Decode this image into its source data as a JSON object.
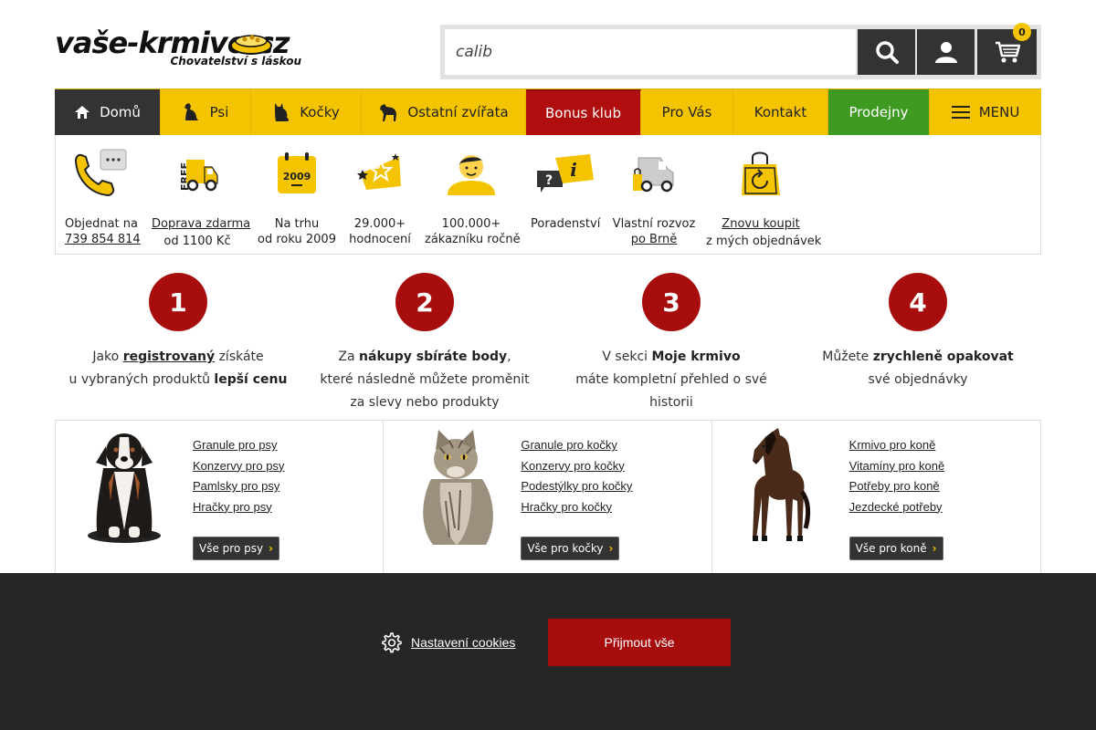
{
  "header": {
    "logo_text": "vaše-krmivo.cz",
    "logo_subtitle": "Chovatelství s láskou",
    "search": {
      "value": "calib",
      "placeholder": ""
    },
    "cart_count": "0"
  },
  "nav": {
    "items": [
      {
        "label": "Domů",
        "icon": "home-icon"
      },
      {
        "label": "Psi",
        "icon": "dog-icon"
      },
      {
        "label": "Kočky",
        "icon": "cat-icon"
      },
      {
        "label": "Ostatní zvířata",
        "icon": "horse-icon"
      },
      {
        "label": "Bonus klub"
      },
      {
        "label": "Pro Vás"
      },
      {
        "label": "Kontakt"
      },
      {
        "label": "Prodejny"
      },
      {
        "label": "MENU",
        "icon": "hamburger-icon"
      }
    ]
  },
  "benefits": [
    {
      "line1": "Objednat na",
      "line2": "739 854 814",
      "icon": "phone-icon"
    },
    {
      "line1": "Doprava zdarma",
      "line2": "od 1100 Kč",
      "icon": "free-delivery-icon"
    },
    {
      "line1": "Na trhu",
      "line2": "od roku 2009",
      "icon": "calendar-icon",
      "calendar_year": "2009"
    },
    {
      "line1": "29.000+",
      "line2": "hodnocení",
      "icon": "stars-icon"
    },
    {
      "line1": "100.000+",
      "line2": "zákazníku ročně",
      "icon": "customer-icon"
    },
    {
      "line1": "Poradenství",
      "line2": "",
      "icon": "advice-icon"
    },
    {
      "line1": "Vlastní rozvoz",
      "line2": "po Brně",
      "icon": "van-icon"
    },
    {
      "line1": "Znovu koupit",
      "line2": "z mých objednávek",
      "icon": "reorder-bag-icon"
    }
  ],
  "steps": [
    {
      "num": "1",
      "p1": "Jako ",
      "b1": "registrovaný",
      "p2": " získáte",
      "p3": "u vybraných produktů ",
      "b2": "lepší cenu"
    },
    {
      "num": "2",
      "p1": "Za ",
      "b1": "nákupy sbíráte body",
      "p2": ",",
      "p3": "které následně můžete proměnit",
      "p4": "za slevy nebo produkty"
    },
    {
      "num": "3",
      "p1": "V sekci ",
      "b1": "Moje krmivo",
      "p3": "máte kompletní přehled o své",
      "p4": "historii"
    },
    {
      "num": "4",
      "p1": "Můžete ",
      "b1": "zrychleně opakovat",
      "p3": "své objednávky"
    }
  ],
  "categories": [
    {
      "links": [
        "Granule pro psy",
        "Konzervy pro psy",
        "Pamlsky pro psy",
        "Hračky pro psy"
      ],
      "all": "Vše pro psy"
    },
    {
      "links": [
        "Granule pro kočky",
        "Konzervy pro kočky",
        "Podestýlky pro kočky",
        "Hračky pro kočky"
      ],
      "all": "Vše pro kočky"
    },
    {
      "links": [
        "Krmivo pro koně",
        "Vitamíny pro koně",
        "Potřeby pro koně",
        "Jezdecké potřeby"
      ],
      "all": "Vše pro koně"
    }
  ],
  "cookie": {
    "settings_label": "Nastavení cookies",
    "accept_label": "Přijmout vše"
  },
  "colors": {
    "yellow": "#f5c400",
    "dark": "#333333",
    "red": "#a80d0d",
    "green": "#3f9a22",
    "cookie_bg": "#262626"
  }
}
